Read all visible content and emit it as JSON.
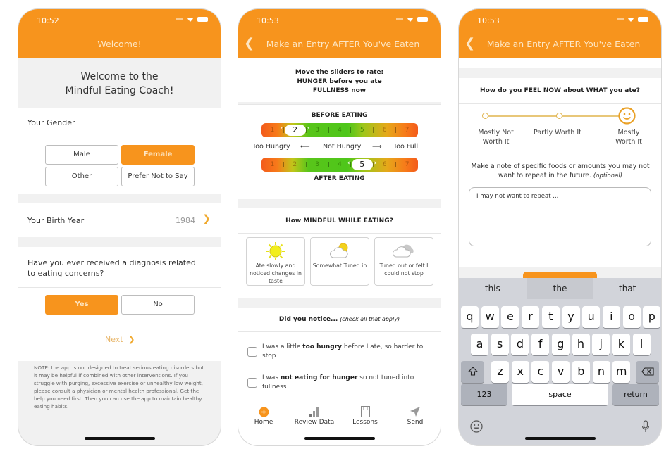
{
  "colors": {
    "brand_orange": "#f7941d",
    "nav_title_text": "#fde6c4",
    "background_gray": "#f1f1f1",
    "accent_gold": "#e0b44f"
  },
  "screen1": {
    "status": {
      "time": "10:52"
    },
    "nav_title": "Welcome!",
    "welcome_line1": "Welcome to the",
    "welcome_line2": "Mindful Eating Coach!",
    "gender": {
      "label": "Your Gender",
      "options": [
        "Male",
        "Female",
        "Other",
        "Prefer Not to Say"
      ],
      "selected": "Female"
    },
    "birth_year": {
      "label": "Your Birth Year",
      "value": "1984"
    },
    "diagnosis": {
      "question": "Have you ever received a diagnosis related to eating concerns?",
      "options": [
        "Yes",
        "No"
      ],
      "selected": "Yes"
    },
    "next_label": "Next",
    "note": "NOTE: the app is not designed to treat serious eating disorders but it may be helpful if combined with other interventions. If you struggle with purging, excessive exercise or unhealthy low weight, please consult a physician or mental health professional. Get the help you need first. Then you can use the app to maintain healthy eating habits."
  },
  "screen2": {
    "status": {
      "time": "10:53"
    },
    "nav_title": "Make an Entry AFTER You've Eaten",
    "instructions": [
      "Move the sliders to rate:",
      "HUNGER before you ate",
      "FULLNESS now"
    ],
    "before_title": "BEFORE EATING",
    "after_title": "AFTER EATING",
    "scale_numbers": [
      "1",
      "2",
      "3",
      "4",
      "5",
      "6",
      "7"
    ],
    "before_value": "2",
    "after_value": "5",
    "scale_labels": {
      "left": "Too Hungry",
      "left_arrow": "⟵",
      "middle": "Not Hungry",
      "right_arrow": "⟶",
      "right": "Too Full"
    },
    "mindful_header": "How MINDFUL WHILE EATING?",
    "mindful_options": [
      {
        "icon": "sun-icon",
        "label": "Ate slowly and noticed changes in taste"
      },
      {
        "icon": "partly-cloudy-icon",
        "label": "Somewhat Tuned in"
      },
      {
        "icon": "cloud-icon",
        "label": "Tuned out or felt I could not stop"
      }
    ],
    "notice_header_bold": "Did you notice...",
    "notice_header_italic": "(check all that apply)",
    "checklist": [
      {
        "pre": "I was a little ",
        "bold": "too hungry",
        "post": " before I ate, so harder to stop",
        "checked": false
      },
      {
        "pre": "I was ",
        "bold": "not eating for hunger",
        "post": " so not tuned into fullness",
        "checked": false
      }
    ],
    "tabs": [
      {
        "icon": "plus-circle-icon",
        "label": "Home"
      },
      {
        "icon": "bar-chart-icon",
        "label": "Review Data"
      },
      {
        "icon": "book-icon",
        "label": "Lessons"
      },
      {
        "icon": "send-icon",
        "label": "Send"
      }
    ]
  },
  "screen3": {
    "status": {
      "time": "10:53"
    },
    "nav_title": "Make an Entry AFTER You've Eaten",
    "feel_header": "How do you FEEL NOW about WHAT you ate?",
    "worth_options": [
      "Mostly Not Worth It",
      "Partly Worth It",
      "Mostly Worth It"
    ],
    "worth_selected": "Mostly Worth It",
    "note_prompt": "Make a note of specific foods or amounts you may not want to repeat in the future.",
    "note_prompt_optional": "(optional)",
    "note_value": "I may not want to repeat ...",
    "keyboard": {
      "suggestions": [
        "this",
        "the",
        "that"
      ],
      "row1": [
        "q",
        "w",
        "e",
        "r",
        "t",
        "y",
        "u",
        "i",
        "o",
        "p"
      ],
      "row2": [
        "a",
        "s",
        "d",
        "f",
        "g",
        "h",
        "j",
        "k",
        "l"
      ],
      "row3": [
        "z",
        "x",
        "c",
        "v",
        "b",
        "n",
        "m"
      ],
      "numbers_key": "123",
      "space_key": "space",
      "return_key": "return"
    }
  }
}
